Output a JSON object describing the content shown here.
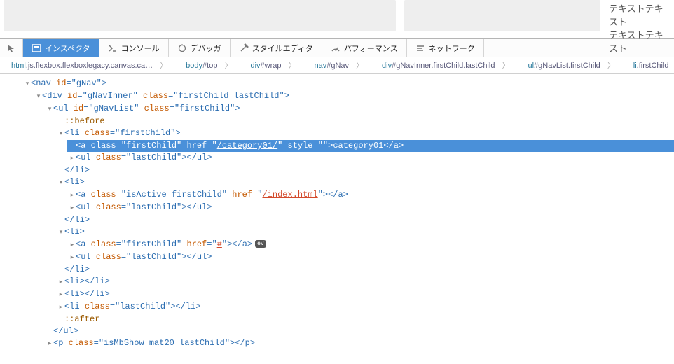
{
  "header_text": {
    "l1": "テキストテキスト",
    "l2": "テキストテキスト"
  },
  "toolbar": {
    "inspector": "インスペクタ",
    "console": "コンソール",
    "debugger": "デバッガ",
    "style_editor": "スタイルエディタ",
    "performance": "パフォーマンス",
    "network": "ネットワーク"
  },
  "breadcrumbs": [
    {
      "tag": "html",
      "extra": ".js.flexbox.flexboxlegacy.canvas.ca…"
    },
    {
      "tag": "body",
      "extra": "#top"
    },
    {
      "tag": "div",
      "extra": "#wrap"
    },
    {
      "tag": "nav",
      "extra": "#gNav"
    },
    {
      "tag": "div",
      "extra": "#gNavInner.firstChild.lastChild"
    },
    {
      "tag": "ul",
      "extra": "#gNavList.firstChild"
    },
    {
      "tag": "li",
      "extra": ".firstChild"
    }
  ],
  "dom": {
    "nav_open": "nav",
    "id_gnav": "gNav",
    "div_open": "div",
    "id_gnavinner": "gNavInner",
    "cls_fc_lc": "firstChild lastChild",
    "ul_open": "ul",
    "id_gnavlist": "gNavList",
    "cls_fc": "firstChild",
    "before": "::before",
    "li": "li",
    "a": "a",
    "href1": "/category01/",
    "text1": "category01",
    "cls_lc": "lastChild",
    "cls_isactive_fc": "isActive firstChild",
    "href2": "/index.html",
    "href3": "#",
    "p_open": "p",
    "cls_p": "isMbShow mat20 lastChild",
    "after": "::after",
    "ev_label": "ev"
  }
}
